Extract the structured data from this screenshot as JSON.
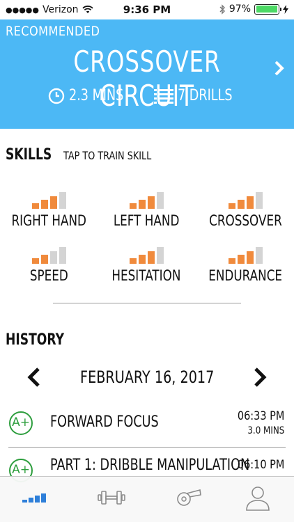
{
  "status_bar": {
    "signal_dots": "●●●●●",
    "carrier": "Verizon",
    "time": "9:36 PM",
    "battery_percent": "97%",
    "battery_level": 0.97
  },
  "hero": {
    "tag": "RECOMMENDED",
    "title": "CROSSOVER CIRCUIT",
    "duration": "2.3 MINS",
    "drills": "7 DRILLS",
    "icons": [
      "clock-icon",
      "list-icon",
      "chevron-right-icon"
    ]
  },
  "skills": {
    "heading": "SKILLS",
    "hint": "TAP TO TRAIN SKILL",
    "items": [
      {
        "label": "RIGHT HAND",
        "level": 3,
        "max": 4
      },
      {
        "label": "LEFT HAND",
        "level": 3,
        "max": 4
      },
      {
        "label": "CROSSOVER",
        "level": 3,
        "max": 4
      },
      {
        "label": "SPEED",
        "level": 2,
        "max": 4
      },
      {
        "label": "HESITATION",
        "level": 3,
        "max": 4
      },
      {
        "label": "ENDURANCE",
        "level": 3,
        "max": 4
      }
    ],
    "colors": {
      "filled": "#f08a3c",
      "empty": "#d4d4d4"
    }
  },
  "history": {
    "heading": "HISTORY",
    "date": "FEBRUARY 16, 2017",
    "entries": [
      {
        "grade": "A+",
        "name": "FORWARD FOCUS",
        "time": "06:33 PM",
        "duration": "3.0 MINS"
      },
      {
        "grade": "A+",
        "name": "PART 1: DRIBBLE MANIPULATION",
        "time": "06:10 PM",
        "duration": ""
      }
    ]
  },
  "tab_bar": {
    "tabs": [
      "skills-tab",
      "workouts-tab",
      "coach-tab",
      "profile-tab"
    ],
    "active": "skills-tab",
    "active_color": "#2e7fd9"
  },
  "colors": {
    "hero_bg": "#4cb8f5",
    "grade": "#2e9e3e",
    "battery": "#4cd964"
  }
}
